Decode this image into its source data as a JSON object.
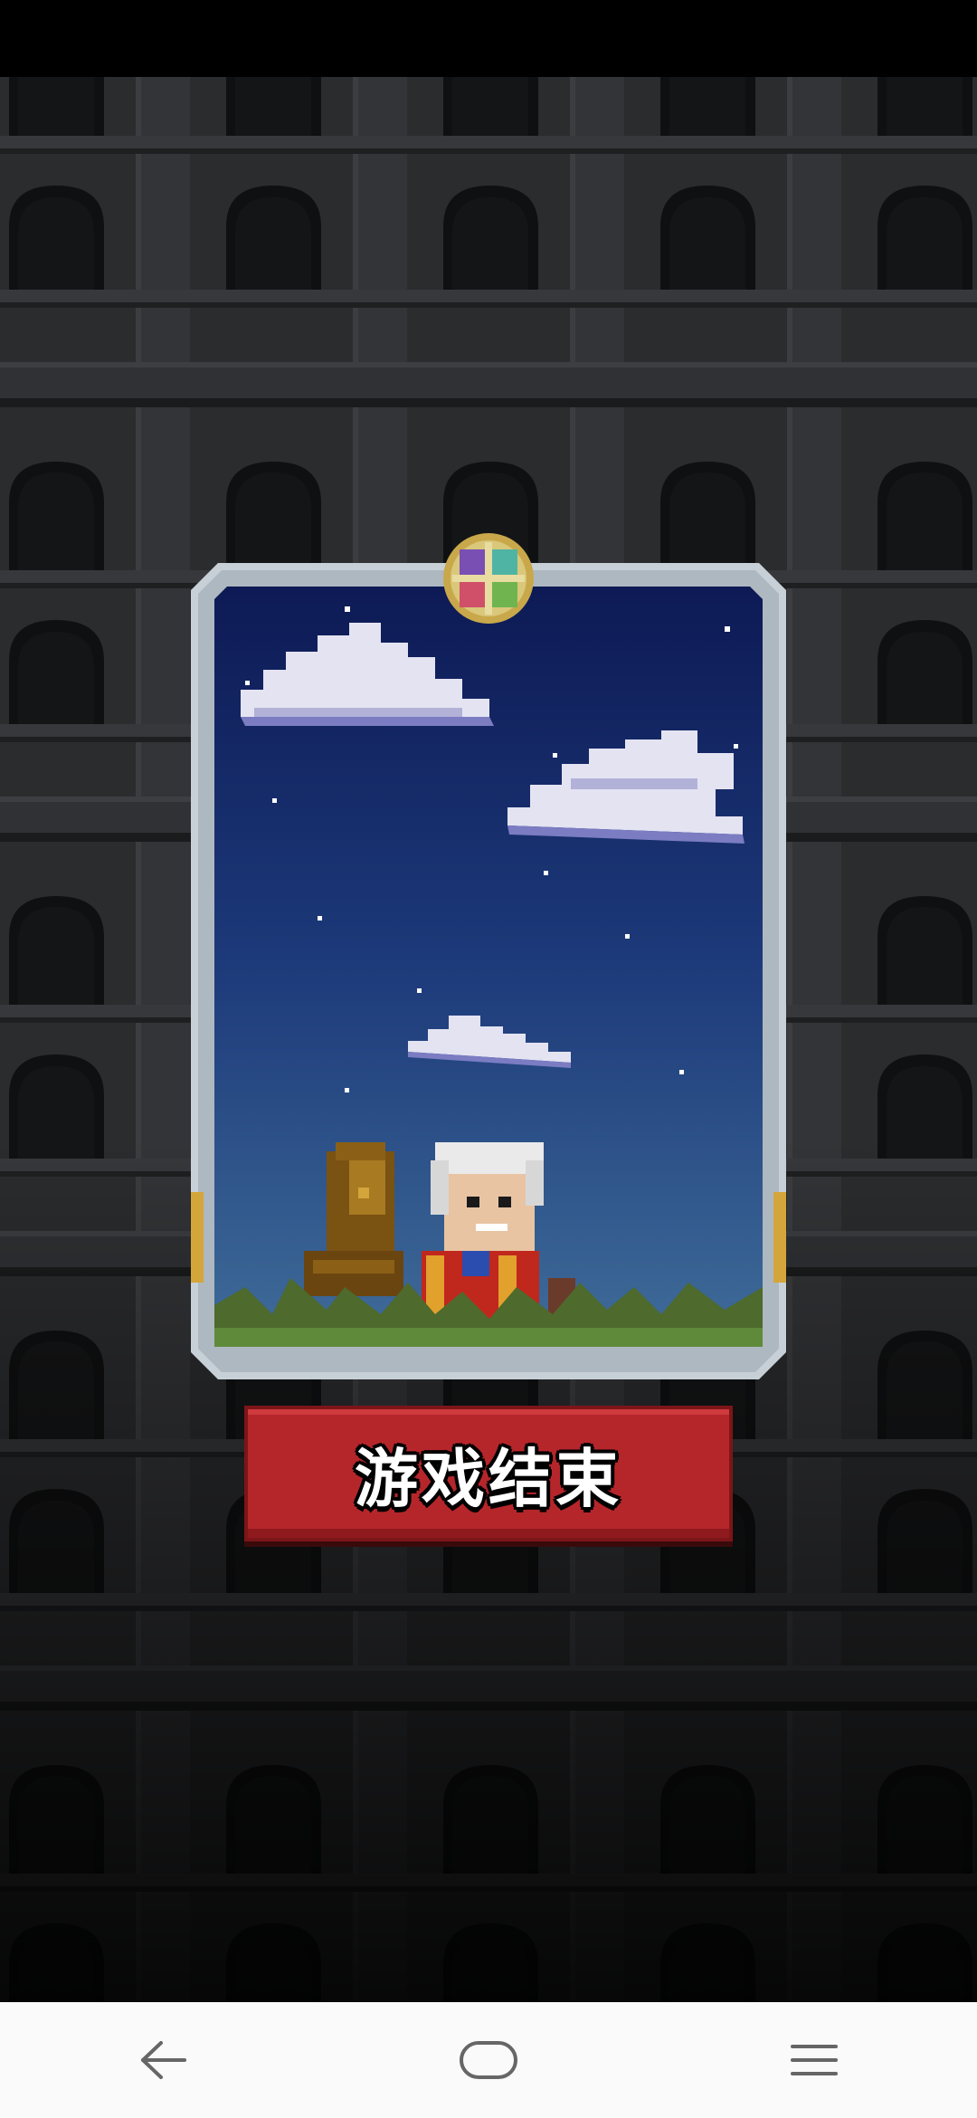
{
  "game_over": {
    "label": "游戏结束"
  },
  "card": {
    "scene": "night-sky-with-clouds",
    "character": "white-haired-king-in-red-robe",
    "throne": "golden-throne",
    "emblem": "four-suit-emblem"
  },
  "nav_bar": {
    "back_icon": "back-arrow-icon",
    "home_icon": "home-icon",
    "menu_icon": "menu-icon"
  },
  "colors": {
    "banner": "#b5262b",
    "sky_top": "#0d1a55",
    "sky_bottom": "#3a6b9c",
    "card_frame": "#c9d3da",
    "background": "#2a2b2d"
  }
}
